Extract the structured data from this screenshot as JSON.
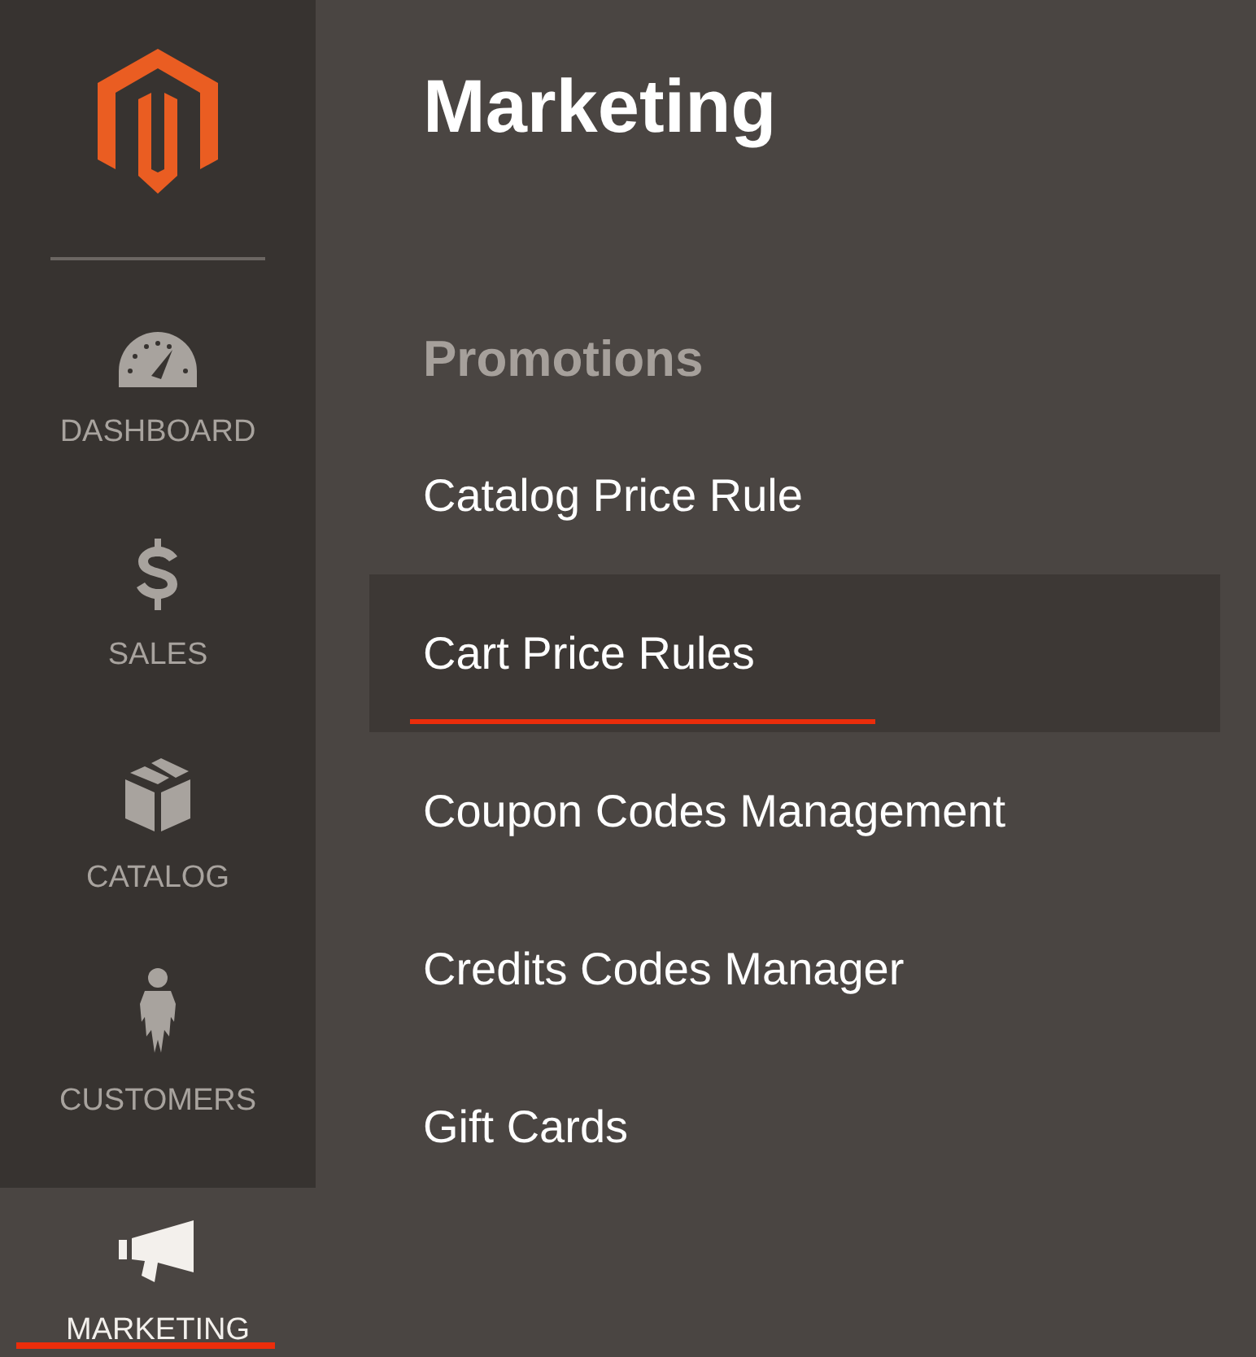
{
  "sidebar": {
    "items": [
      {
        "label": "DASHBOARD",
        "selected": false
      },
      {
        "label": "SALES",
        "selected": false
      },
      {
        "label": "CATALOG",
        "selected": false
      },
      {
        "label": "CUSTOMERS",
        "selected": false
      },
      {
        "label": "MARKETING",
        "selected": true
      }
    ]
  },
  "menu": {
    "title": "Marketing",
    "section": "Promotions",
    "items": [
      {
        "label": "Catalog Price Rule",
        "selected": false
      },
      {
        "label": "Cart Price Rules",
        "selected": true
      },
      {
        "label": "Coupon Codes Management",
        "selected": false
      },
      {
        "label": "Credits Codes Manager",
        "selected": false
      },
      {
        "label": "Gift Cards",
        "selected": false
      }
    ]
  }
}
